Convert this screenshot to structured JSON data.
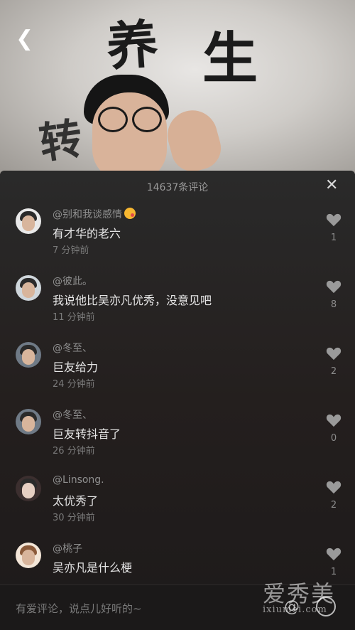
{
  "video": {
    "calligraphy": [
      "养",
      "生",
      "转"
    ]
  },
  "panel": {
    "title": "14637条评论",
    "close_glyph": "✕"
  },
  "comments": [
    {
      "username": "@别和我谈感情",
      "text": "有才华的老六",
      "time": "7 分钟前",
      "likes": "1",
      "has_emoji": true
    },
    {
      "username": "@彼此。",
      "text": "我说他比吴亦凡优秀，没意见吧",
      "time": "11 分钟前",
      "likes": "8"
    },
    {
      "username": "@冬至、",
      "text": "巨友给力",
      "time": "24 分钟前",
      "likes": "2"
    },
    {
      "username": "@冬至、",
      "text": "巨友转抖音了",
      "time": "26 分钟前",
      "likes": "0"
    },
    {
      "username": "@Linsong.",
      "text": "太优秀了",
      "time": "30 分钟前",
      "likes": "2"
    },
    {
      "username": "@桃子",
      "text": "吴亦凡是什么梗",
      "time": "",
      "likes": "1"
    }
  ],
  "input": {
    "placeholder": "有爱评论，说点儿好听的~",
    "at_glyph": "@"
  },
  "watermark": {
    "main": "爱秀美",
    "sub": "ixiumei.com"
  },
  "colors": {
    "panel_bg": "#241f1e",
    "text_primary": "#e6e6e6",
    "text_secondary": "#8f8f8f",
    "heart": "#9a9a9a"
  }
}
